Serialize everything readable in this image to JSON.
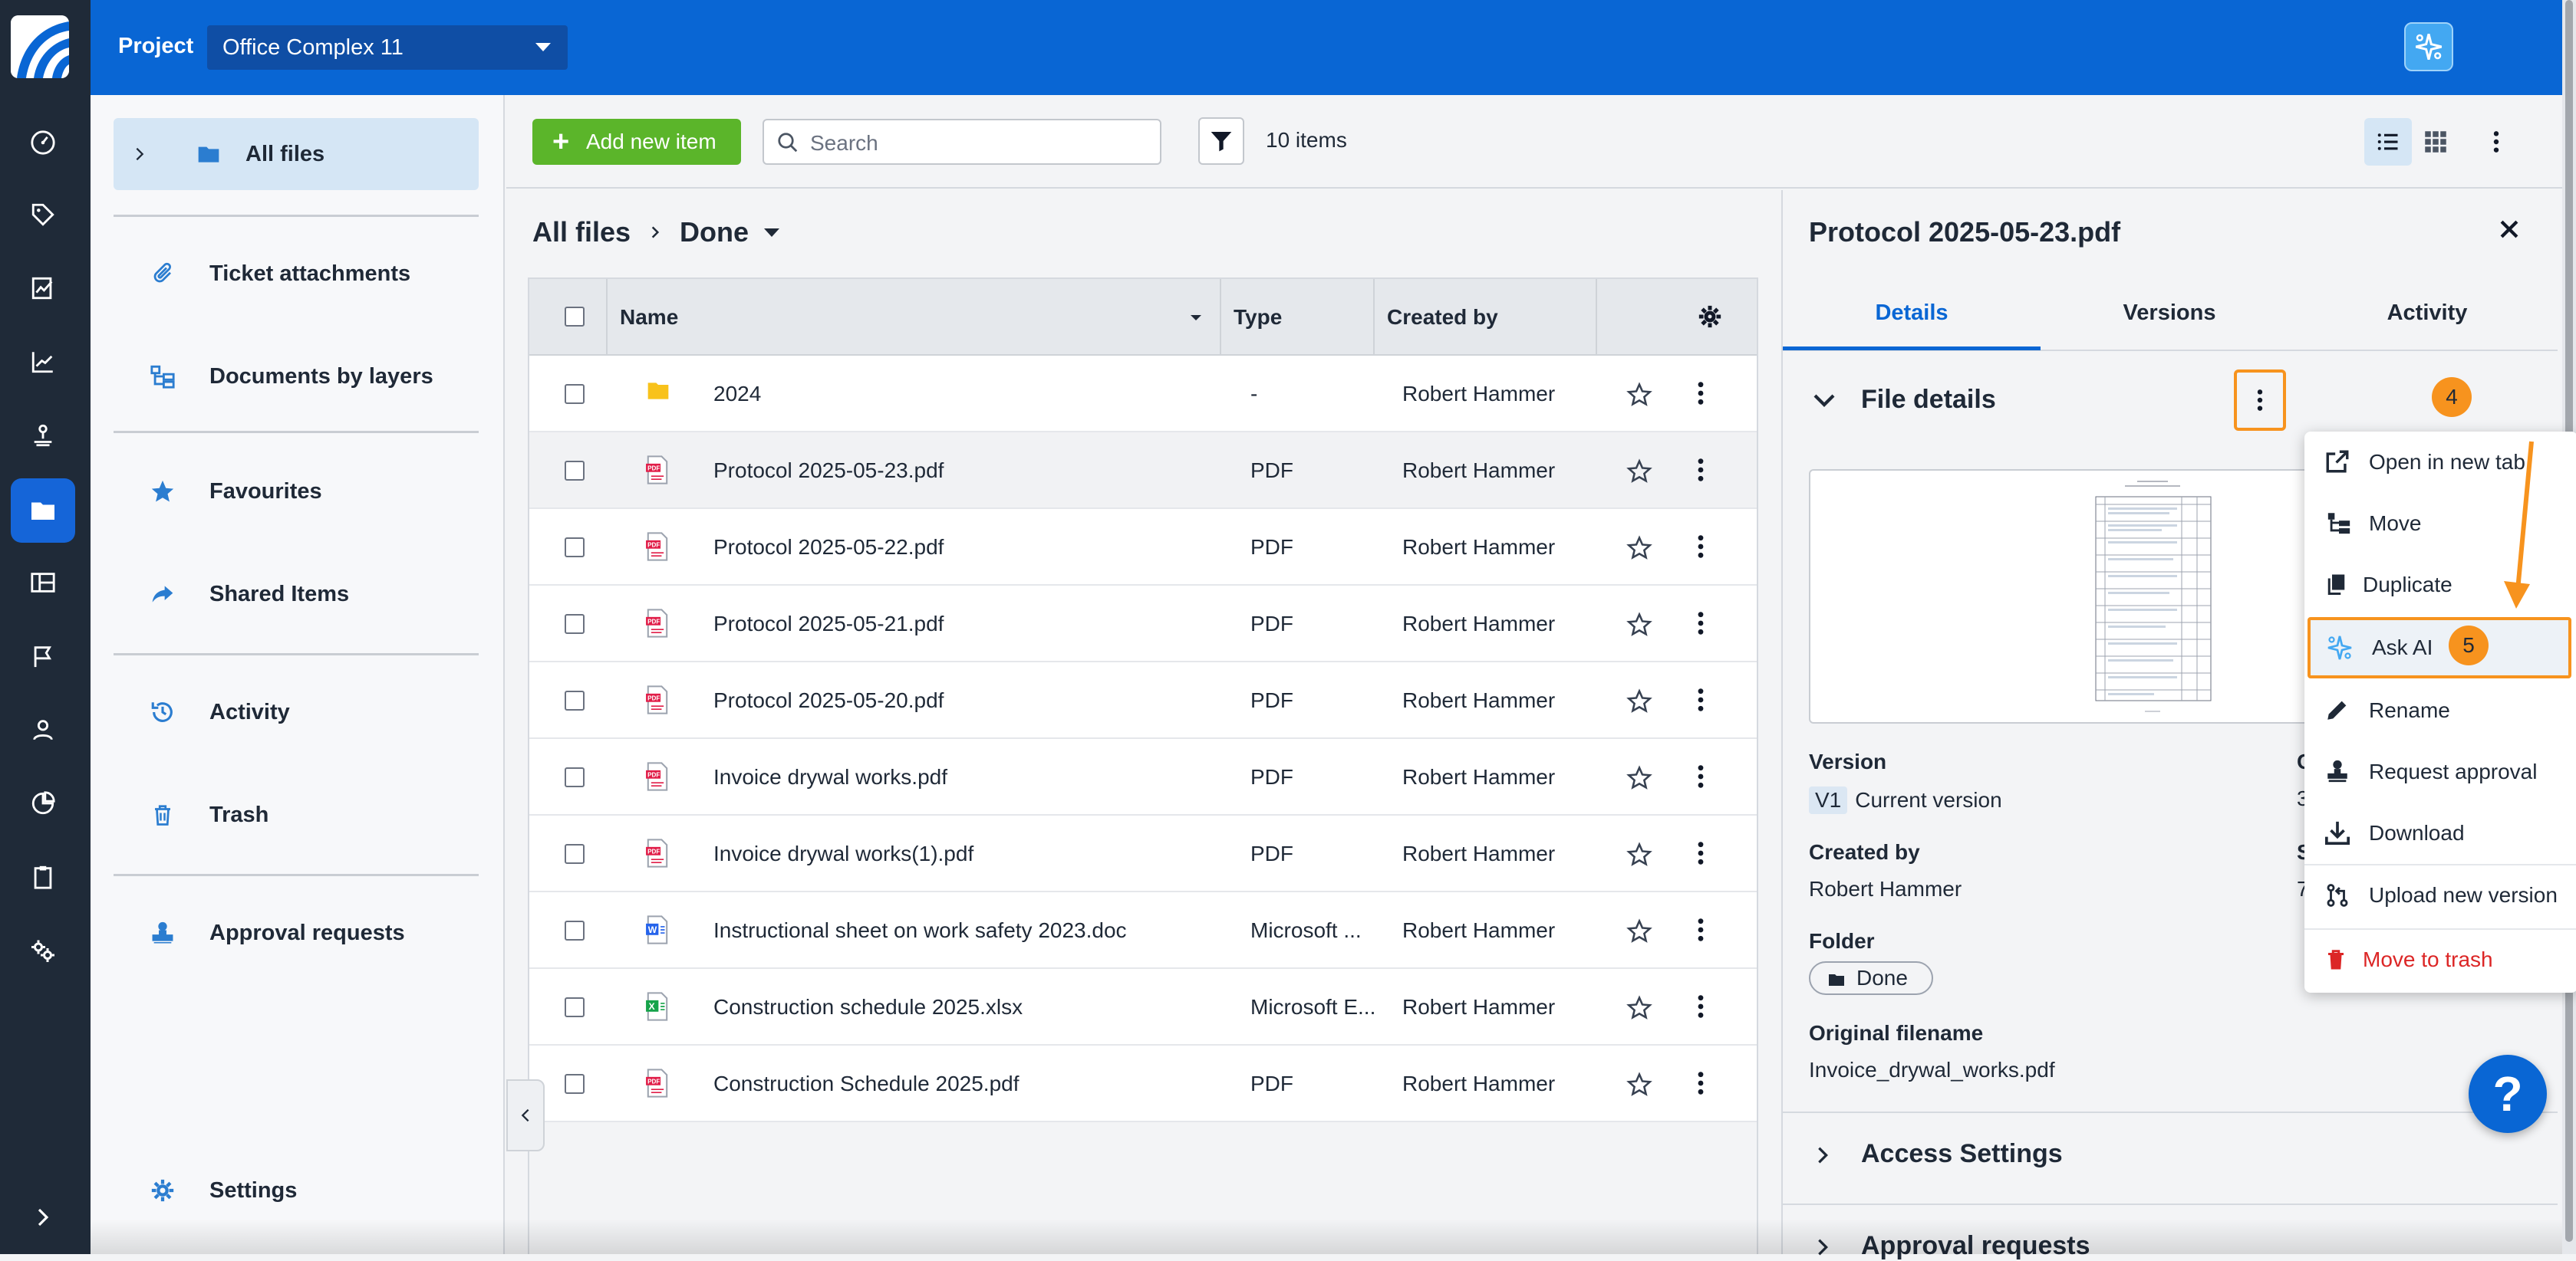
{
  "topbar": {
    "project_label": "Project",
    "project_value": "Office Complex 11"
  },
  "sidebar": {
    "items": [
      {
        "label": "All files",
        "icon": "folder-icon"
      },
      {
        "label": "Ticket attachments",
        "icon": "paperclip-icon"
      },
      {
        "label": "Documents by layers",
        "icon": "layers-tree-icon"
      },
      {
        "label": "Favourites",
        "icon": "star-icon"
      },
      {
        "label": "Shared Items",
        "icon": "share-icon"
      },
      {
        "label": "Activity",
        "icon": "history-icon"
      },
      {
        "label": "Trash",
        "icon": "trash-icon"
      },
      {
        "label": "Approval requests",
        "icon": "stamp-icon"
      },
      {
        "label": "Settings",
        "icon": "gear-icon"
      }
    ]
  },
  "toolbar": {
    "add_label": "Add new item",
    "search_placeholder": "Search",
    "count": "10 items"
  },
  "breadcrumb": {
    "root": "All files",
    "current": "Done"
  },
  "table": {
    "columns": [
      "Name",
      "Type",
      "Created by"
    ],
    "rows": [
      {
        "name": "2024",
        "type": "-",
        "created_by": "Robert Hammer",
        "icon": "folder-icon"
      },
      {
        "name": "Protocol 2025-05-23.pdf",
        "type": "PDF",
        "created_by": "Robert Hammer",
        "icon": "pdf-icon"
      },
      {
        "name": "Protocol 2025-05-22.pdf",
        "type": "PDF",
        "created_by": "Robert Hammer",
        "icon": "pdf-icon"
      },
      {
        "name": "Protocol 2025-05-21.pdf",
        "type": "PDF",
        "created_by": "Robert Hammer",
        "icon": "pdf-icon"
      },
      {
        "name": "Protocol 2025-05-20.pdf",
        "type": "PDF",
        "created_by": "Robert Hammer",
        "icon": "pdf-icon"
      },
      {
        "name": "Invoice drywal works.pdf",
        "type": "PDF",
        "created_by": "Robert Hammer",
        "icon": "pdf-icon"
      },
      {
        "name": "Invoice drywal works(1).pdf",
        "type": "PDF",
        "created_by": "Robert Hammer",
        "icon": "pdf-icon"
      },
      {
        "name": "Instructional sheet on work safety 2023.doc",
        "type": "Microsoft ...",
        "created_by": "Robert Hammer",
        "icon": "word-icon"
      },
      {
        "name": "Construction schedule 2025.xlsx",
        "type": "Microsoft E...",
        "created_by": "Robert Hammer",
        "icon": "excel-icon"
      },
      {
        "name": "Construction Schedule 2025.pdf",
        "type": "PDF",
        "created_by": "Robert Hammer",
        "icon": "pdf-icon"
      }
    ]
  },
  "detail": {
    "title": "Protocol 2025-05-23.pdf",
    "tabs": [
      "Details",
      "Versions",
      "Activity"
    ],
    "section_file": "File details",
    "version_label": "Version",
    "version_tag": "V1",
    "version_value": "Current version",
    "created_label": "Created by",
    "created_value": "Robert Hammer",
    "folder_label": "Folder",
    "folder_value": "Done",
    "orig_label": "Original filename",
    "orig_value": "Invoice_drywal_works.pdf",
    "section_access": "Access Settings",
    "section_approval": "Approval requests",
    "partial_1": "C",
    "partial_2": "3",
    "partial_3": "S",
    "partial_4": "7"
  },
  "menu": {
    "items": [
      {
        "label": "Open in new tab",
        "icon": "external-link-icon"
      },
      {
        "label": "Move",
        "icon": "move-icon"
      },
      {
        "label": "Duplicate",
        "icon": "duplicate-icon"
      },
      {
        "label": "Ask AI",
        "icon": "ai-icon"
      },
      {
        "label": "Rename",
        "icon": "pencil-icon"
      },
      {
        "label": "Request approval",
        "icon": "stamp-icon"
      },
      {
        "label": "Download",
        "icon": "download-icon"
      },
      {
        "label": "Upload new version",
        "icon": "upload-version-icon"
      },
      {
        "label": "Move to trash",
        "icon": "trash-icon"
      }
    ]
  },
  "annotations": {
    "step4": "4",
    "step5": "5"
  },
  "help": "?",
  "colors": {
    "topbar": "#0966d4",
    "rail": "#1f2a38",
    "accent": "#0966d4",
    "add_button": "#5bb52a",
    "annotation": "#f7931e",
    "danger": "#dc2626"
  }
}
